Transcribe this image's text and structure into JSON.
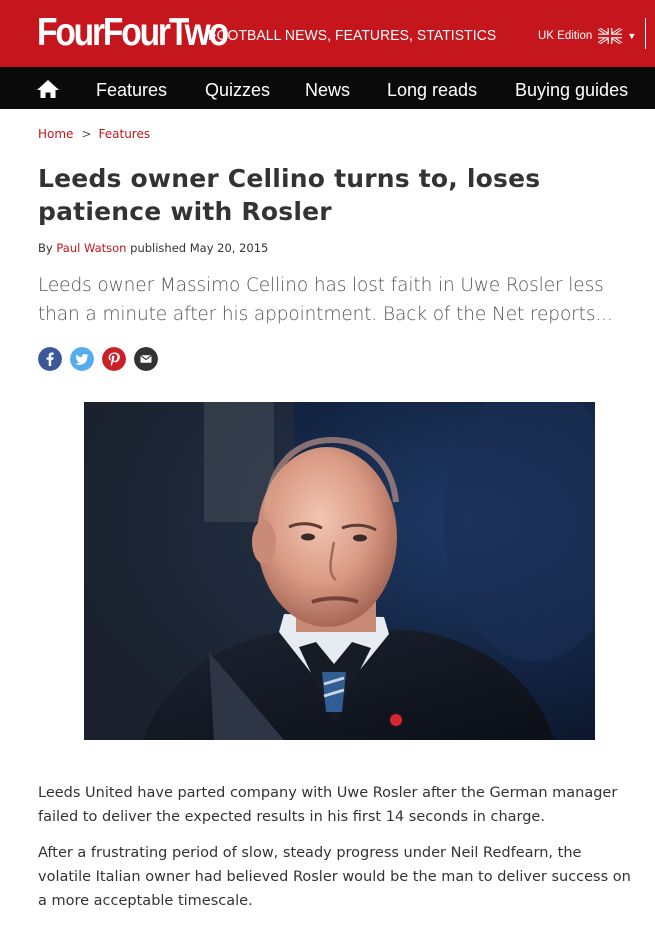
{
  "header": {
    "logo_text": "FourFourTwo",
    "tagline": "FOOTBALL NEWS, FEATURES, STATISTICS",
    "edition_label": "UK Edition",
    "brand_color": "#c4161c"
  },
  "nav": {
    "home_icon": "home-icon",
    "items": [
      {
        "label": "Features"
      },
      {
        "label": "Quizzes"
      },
      {
        "label": "News"
      },
      {
        "label": "Long reads"
      },
      {
        "label": "Buying guides"
      }
    ]
  },
  "breadcrumb": {
    "home": "Home",
    "separator": ">",
    "section": "Features"
  },
  "article": {
    "title": "Leeds owner Cellino turns to, loses patience with Rosler",
    "byline_prefix": "By",
    "author": "Paul Watson",
    "published_prefix": "published",
    "date": "May 20, 2015",
    "standfirst": "Leeds owner Massimo Cellino has lost faith in Uwe Rosler less than a minute after his appointment. Back of the Net reports...",
    "share": [
      "facebook-icon",
      "twitter-icon",
      "pinterest-icon",
      "email-icon"
    ],
    "paragraphs": [
      "Leeds United have parted company with Uwe Rosler after the German manager failed to deliver the expected results in his first 14 seconds in charge.",
      "After a frustrating period of slow, steady progress under Neil Redfearn, the volatile Italian owner had believed Rosler would be the man to deliver success on a more acceptable timescale."
    ]
  }
}
